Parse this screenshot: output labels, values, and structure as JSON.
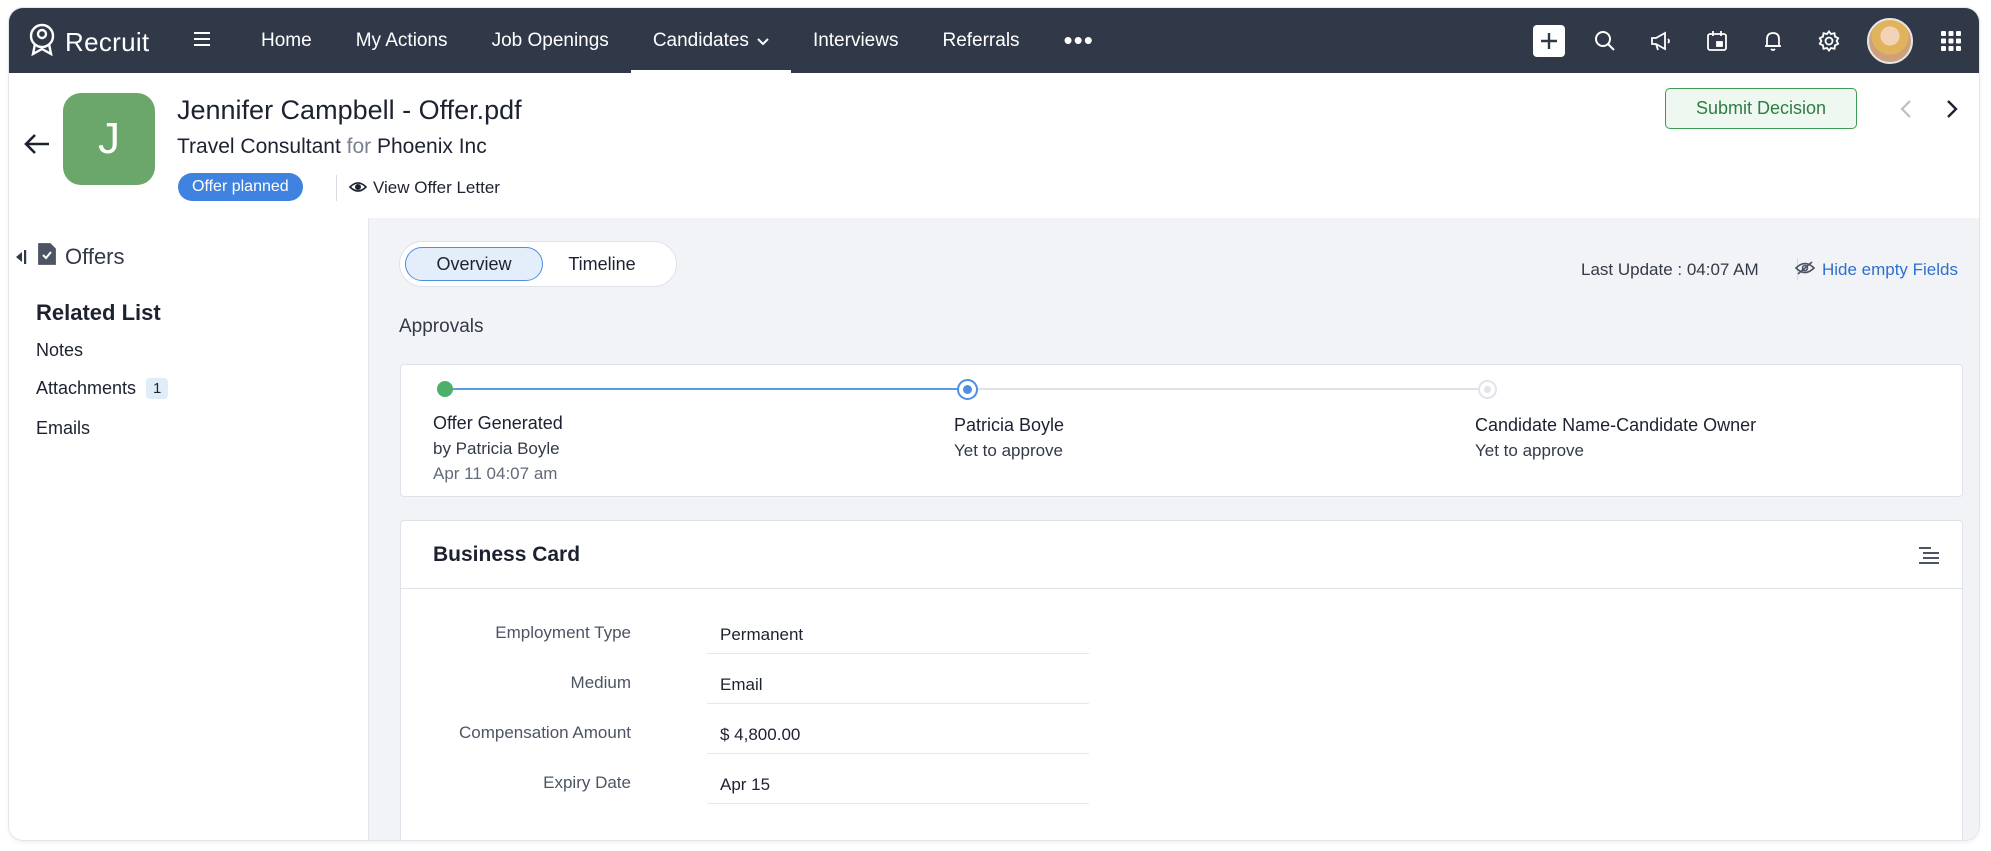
{
  "app": {
    "name": "Recruit"
  },
  "nav": {
    "items": [
      {
        "label": "Home"
      },
      {
        "label": "My Actions"
      },
      {
        "label": "Job Openings"
      },
      {
        "label": "Candidates"
      },
      {
        "label": "Interviews"
      },
      {
        "label": "Referrals"
      }
    ],
    "more": "•••",
    "active": "Candidates"
  },
  "header": {
    "avatar_initial": "J",
    "avatar_color": "#6ba66a",
    "title": "Jennifer Campbell - Offer.pdf",
    "job": "Travel Consultant",
    "for_word": "for",
    "company": "Phoenix Inc",
    "status": "Offer planned",
    "view_offer": "View Offer Letter",
    "submit": "Submit Decision"
  },
  "left": {
    "section": "Offers",
    "related_title": "Related List",
    "items": [
      {
        "label": "Notes"
      },
      {
        "label": "Attachments",
        "count": "1"
      },
      {
        "label": "Emails"
      }
    ]
  },
  "main": {
    "tabs": [
      {
        "label": "Overview"
      },
      {
        "label": "Timeline"
      }
    ],
    "last_update": "Last Update : 04:07 AM",
    "hide_empty": "Hide empty Fields",
    "approvals_title": "Approvals",
    "steps": [
      {
        "title": "Offer Generated",
        "sub": "by Patricia Boyle",
        "time": "Apr 11 04:07 am",
        "state": "done"
      },
      {
        "title": "Patricia Boyle",
        "sub": "Yet to approve",
        "state": "current"
      },
      {
        "title": "Candidate Name-Candidate Owner",
        "sub": "Yet to approve",
        "state": "pending"
      }
    ],
    "business_card": {
      "title": "Business Card",
      "fields": [
        {
          "label": "Employment Type",
          "value": "Permanent"
        },
        {
          "label": "Medium",
          "value": "Email"
        },
        {
          "label": "Compensation Amount",
          "value": "$ 4,800.00"
        },
        {
          "label": "Expiry Date",
          "value": "Apr 15"
        }
      ]
    }
  },
  "colors": {
    "topbar": "#313949",
    "accent": "#3f82e0",
    "success": "#3f9a55",
    "done_dot": "#4caf6a"
  }
}
